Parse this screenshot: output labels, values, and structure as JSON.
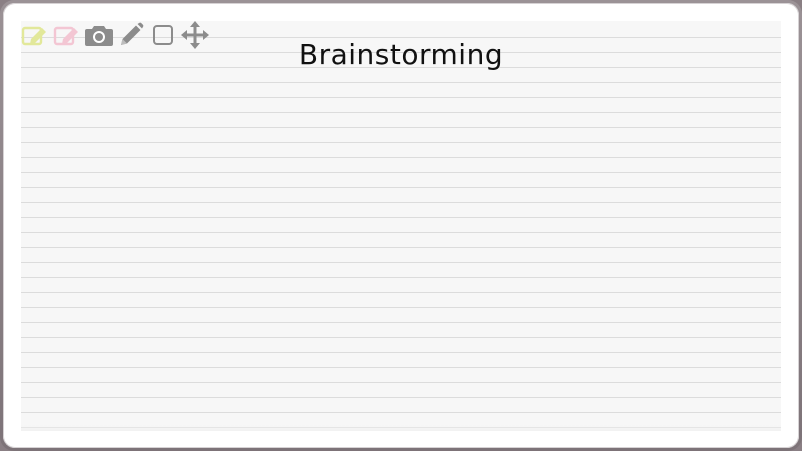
{
  "note": {
    "title": "Brainstorming"
  },
  "toolbar": {
    "items": [
      {
        "name": "edit-yellow",
        "icon": "edit-note-icon",
        "color": "#e2e89a"
      },
      {
        "name": "edit-pink",
        "icon": "edit-note-icon",
        "color": "#f3c6d3"
      },
      {
        "name": "camera",
        "icon": "camera-icon",
        "color": "#8c8c8c"
      },
      {
        "name": "pencil",
        "icon": "pencil-icon",
        "color": "#8c8c8c"
      },
      {
        "name": "checkbox",
        "icon": "square-icon",
        "color": "#8c8c8c"
      },
      {
        "name": "move",
        "icon": "move-arrows-icon",
        "color": "#8c8c8c"
      }
    ]
  }
}
